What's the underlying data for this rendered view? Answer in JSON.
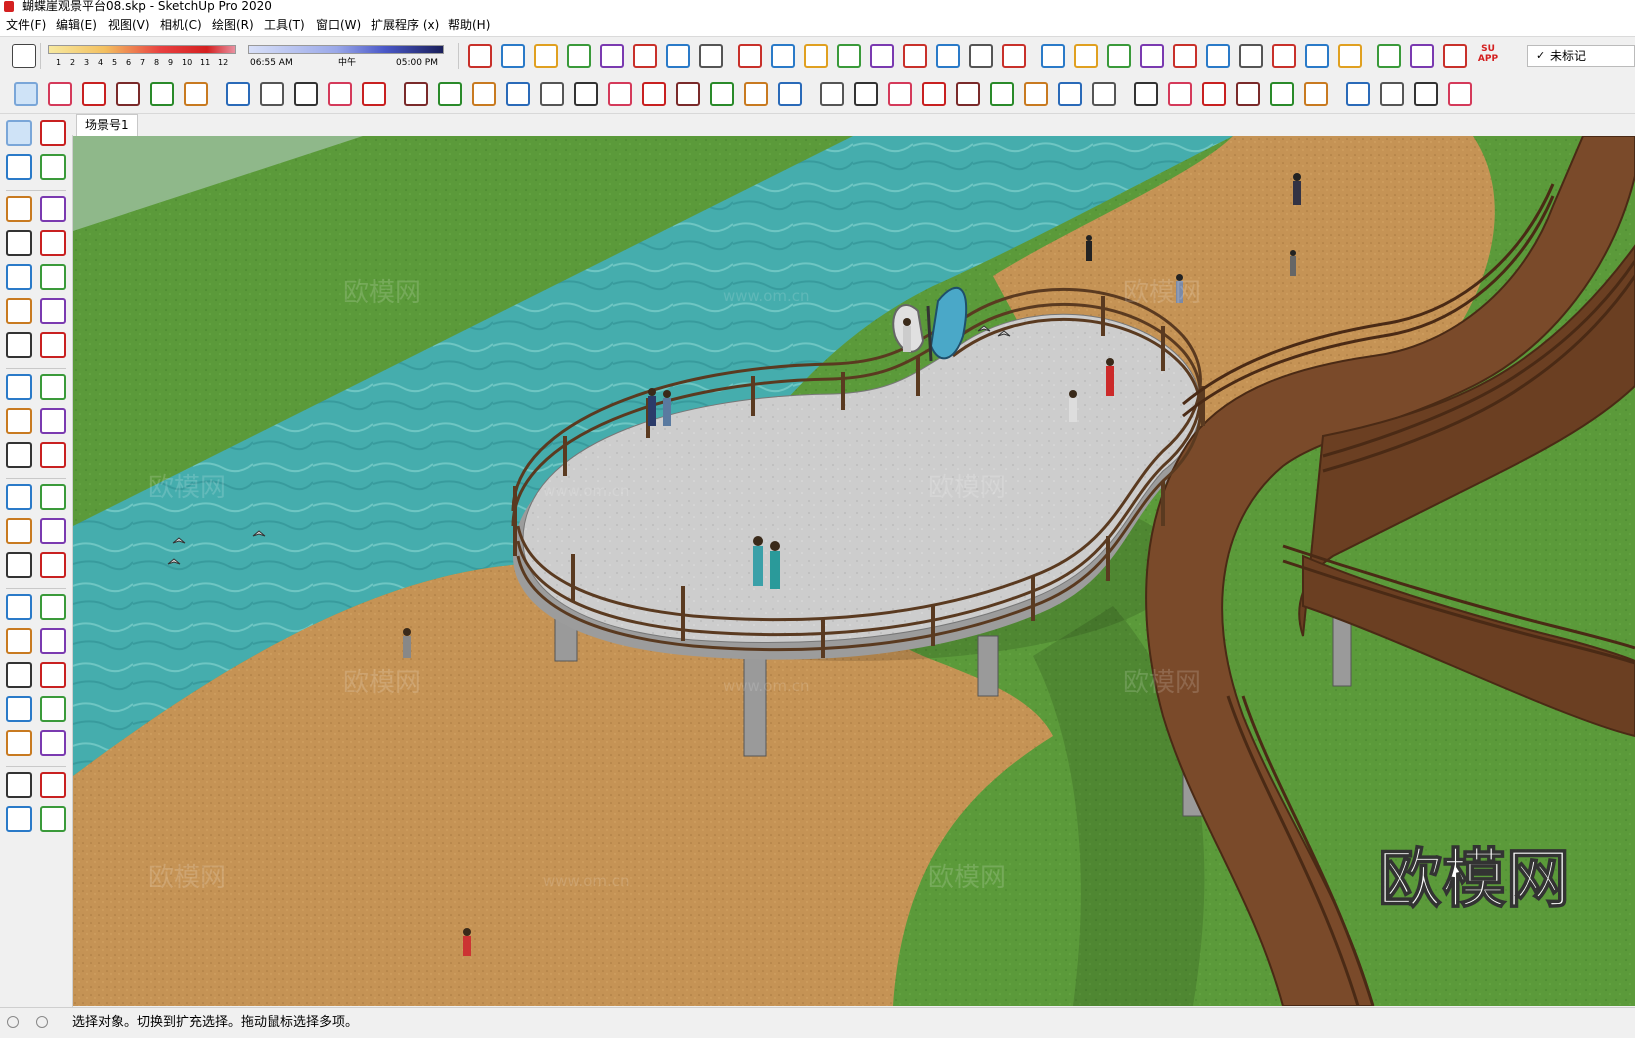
{
  "window": {
    "title": "蝴蝶崖观景平台08.skp - SketchUp Pro 2020"
  },
  "menu": [
    "文件(F)",
    "编辑(E)",
    "视图(V)",
    "相机(C)",
    "绘图(R)",
    "工具(T)",
    "窗口(W)",
    "扩展程序 (x)",
    "帮助(H)"
  ],
  "shadow_settings": {
    "month_ticks": [
      "1",
      "2",
      "3",
      "4",
      "5",
      "6",
      "7",
      "8",
      "9",
      "10",
      "11",
      "12"
    ],
    "time_start": "06:55 AM",
    "time_mid": "中午",
    "time_end": "05:00 PM"
  },
  "tag_selector": {
    "value": "未标记"
  },
  "toolbar2_app_badge": "SU APP",
  "scene_tab": "场景号1",
  "viewport_watermark": "欧模网",
  "viewport_watermarks_faint": [
    "欧模网",
    "www.om.cn"
  ],
  "status_bar": {
    "text": "选择对象。切换到扩充选择。拖动鼠标选择多项。"
  },
  "colors": {
    "grass": "#5e9a3c",
    "water": "#3fa6a6",
    "sand": "#c59355",
    "deck": "#c9c9c9",
    "railing_wood": "#6b4425",
    "boardwalk": "#7a4a2a"
  },
  "toolbar1_icons": [
    "eraser-style-icon",
    "section-plane-icon",
    "front-view-icon",
    "back-view-icon",
    "left-view-icon",
    "iso-icon",
    "walk-icon",
    "layer-icon",
    "check-icon",
    "axes-icon",
    "tape-icon",
    "compass-icon",
    "box-icon",
    "xray-icon",
    "bar-chart-icon",
    "curve-icon",
    "trim-icon",
    "kg-icon",
    "mirror-icon",
    "upload-icon",
    "arc-icon",
    "rotate-red-icon",
    "grid-icon",
    "scale-icon",
    "ml-icon",
    "target-icon",
    "camera-icon",
    "red-box-icon",
    "bucket-icon",
    "wifi-icon",
    "su-app-icon"
  ],
  "toolbar2_icons": [
    "select-icon",
    "eraser-icon",
    "pencil-icon",
    "line-dropdown-icon",
    "arc-dropdown-icon",
    "shape-dropdown-icon",
    "push-pull-icon",
    "follow-me-icon",
    "move-icon",
    "rotate-icon",
    "scale-icon",
    "tape-measure-icon",
    "text-icon",
    "paint-bucket-icon",
    "orbit-icon",
    "pan-icon",
    "zoom-icon",
    "zoom-extents-icon",
    "warehouse-icon",
    "extension-icon",
    "share-icon",
    "ruby-icon",
    "user-icon",
    "import-icon",
    "photo-icon",
    "grid-plane-icon",
    "sandbox-icon",
    "stamp-icon",
    "drape-icon",
    "flip-icon",
    "smoove-icon",
    "add-detail-icon",
    "terrain-icon",
    "ai-icon",
    "3d-text-icon",
    "image-icon",
    "book-icon",
    "help-icon",
    "cube-icon",
    "box-outline-icon",
    "box-frame-icon",
    "box-solid-icon"
  ],
  "left_toolbar_icons": [
    "select-icon",
    "component-icon",
    "paint-bucket-icon",
    "eraser-icon",
    "line-icon",
    "freehand-icon",
    "rectangle-icon",
    "rotated-rectangle-icon",
    "circle-icon",
    "polygon-icon",
    "arc-icon",
    "two-point-arc-icon",
    "three-point-arc-icon",
    "pie-icon",
    "move-icon",
    "push-pull-icon",
    "rotate-icon",
    "follow-me-icon",
    "scale-icon",
    "offset-icon",
    "tape-measure-icon",
    "dimension-icon",
    "protractor-icon",
    "text-icon",
    "axes-icon",
    "3d-text-icon",
    "orbit-icon",
    "pan-icon",
    "zoom-icon",
    "zoom-window-icon",
    "zoom-extents-icon",
    "previous-view-icon",
    "position-camera-icon",
    "look-around-icon",
    "walk-icon",
    "section-plane-icon",
    "warehouse-icon",
    "extension-warehouse-icon",
    "share-model-icon",
    "ruby-icon"
  ]
}
